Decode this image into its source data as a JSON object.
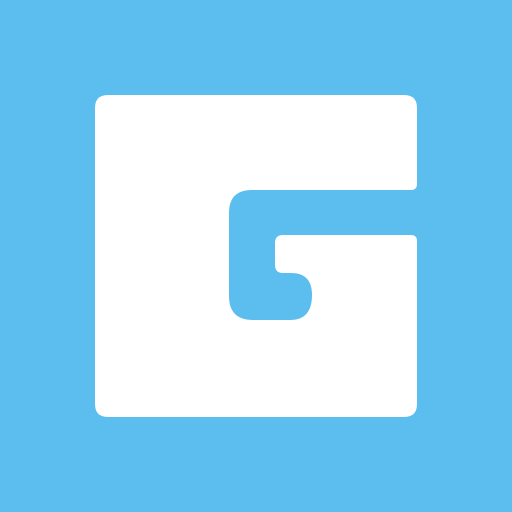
{
  "app_icon": {
    "glyph": "g-logo-icon",
    "colors": {
      "background": "#5BBEEE",
      "foreground": "#FFFFFF"
    }
  }
}
